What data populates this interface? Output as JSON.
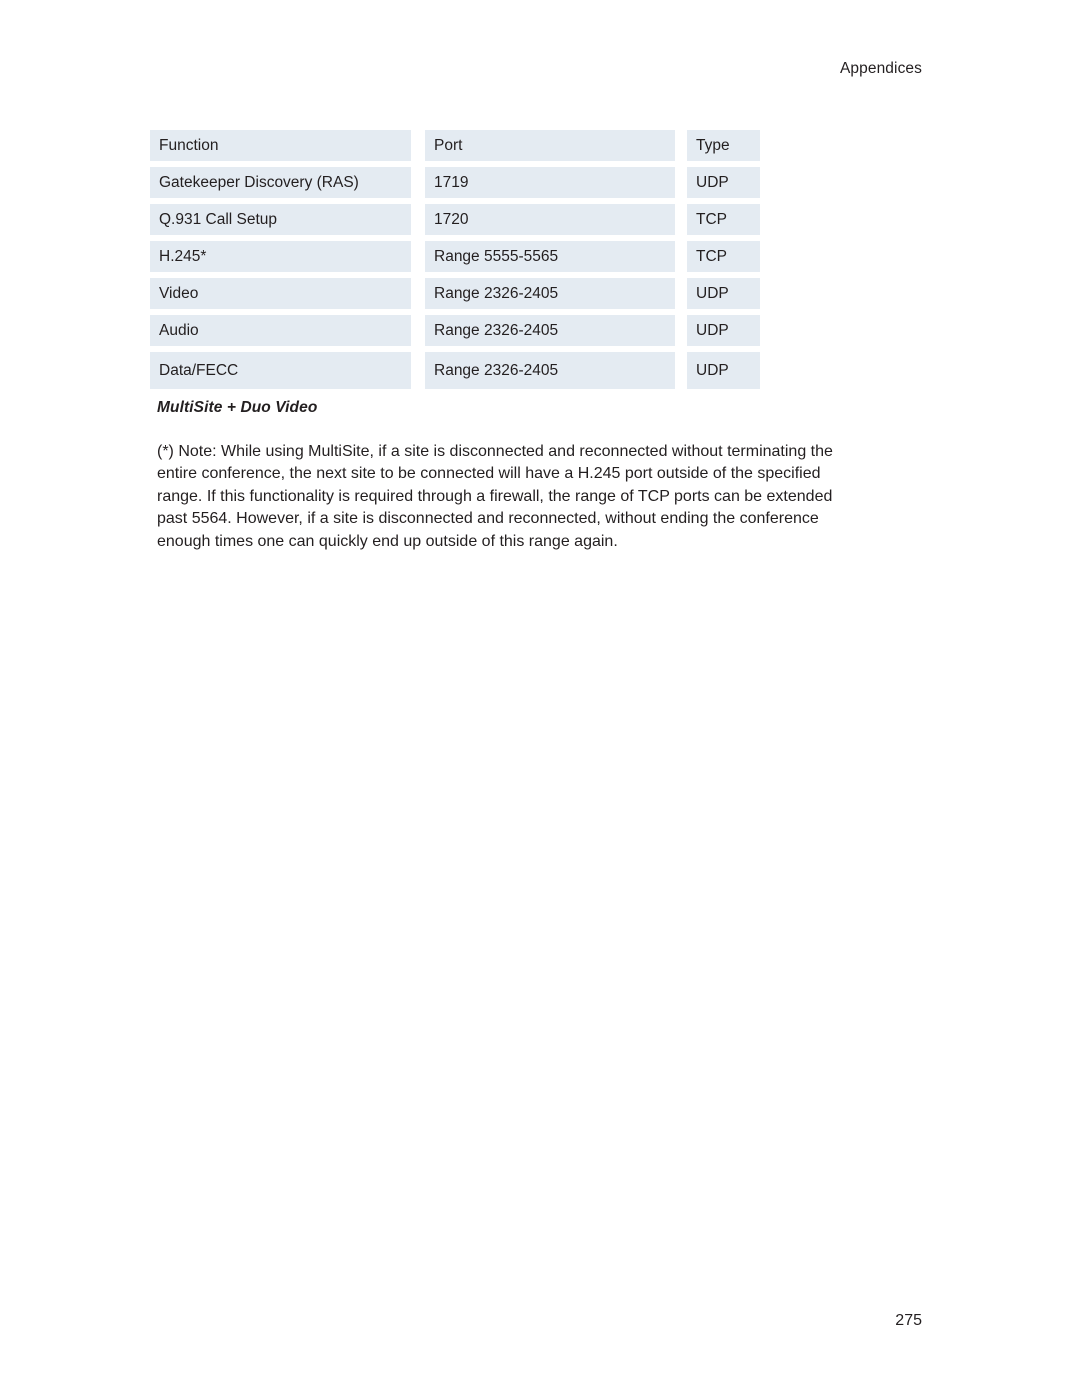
{
  "page": {
    "running_header": "Appendices",
    "folio": "275"
  },
  "table": {
    "columns": [
      "Function",
      "Port",
      "Type"
    ],
    "rows": [
      {
        "function": "Function",
        "port": "Port",
        "type": "Type",
        "is_header": true
      },
      {
        "function": "Gatekeeper Discovery (RAS)",
        "port": "1719",
        "type": "UDP"
      },
      {
        "function": "Q.931 Call Setup",
        "port": "1720",
        "type": "TCP"
      },
      {
        "function": "H.245*",
        "port": "Range 5555-5565",
        "type": "TCP"
      },
      {
        "function": "Video",
        "port": "Range 2326-2405",
        "type": "UDP"
      },
      {
        "function": "Audio",
        "port": "Range 2326-2405",
        "type": "UDP"
      },
      {
        "function": "Data/FECC",
        "port": "Range 2326-2405",
        "type": "UDP"
      }
    ],
    "caption": "MultiSite + Duo Video"
  },
  "note": {
    "lines": [
      "(*) Note: While using MultiSite, if a site is disconnected and reconnected without terminating the",
      "entire conference, the next site to be connected will have a H.245 port outside of the specified",
      "range. If this functionality is required through a firewall, the range of TCP ports can be extended",
      "past 5564. However, if a site is disconnected and reconnected, without ending the conference",
      "enough times one can quickly end up outside of this range again."
    ]
  },
  "colors": {
    "cell_background": "#e4ebf2",
    "text": "#231f20",
    "page_background": "#ffffff"
  }
}
